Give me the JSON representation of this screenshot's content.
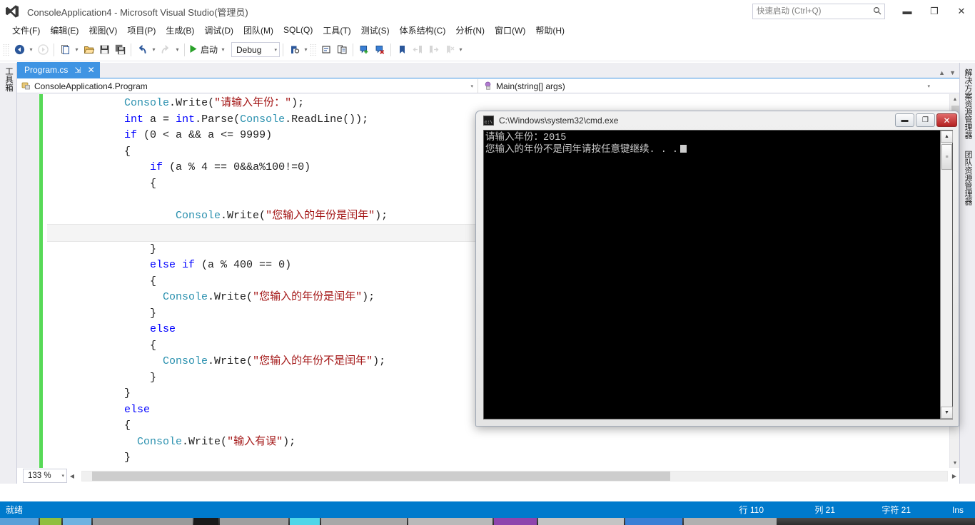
{
  "titlebar": {
    "title": "ConsoleApplication4 - Microsoft Visual Studio(管理员)",
    "logo_icon": "visual-studio-logo",
    "quick_launch_placeholder": "快速启动 (Ctrl+Q)",
    "quick_launch_value": "",
    "search_icon": "search-icon",
    "minimize_icon": "minimize-icon",
    "maximize_icon": "maximize-restore-icon",
    "close_icon": "close-icon",
    "minimize_glyph": "▬",
    "maximize_glyph": "❐",
    "close_glyph": "✕"
  },
  "menubar": {
    "items": [
      {
        "label": "文件(F)"
      },
      {
        "label": "编辑(E)"
      },
      {
        "label": "视图(V)"
      },
      {
        "label": "项目(P)"
      },
      {
        "label": "生成(B)"
      },
      {
        "label": "调试(D)"
      },
      {
        "label": "团队(M)"
      },
      {
        "label": "SQL(Q)"
      },
      {
        "label": "工具(T)"
      },
      {
        "label": "测试(S)"
      },
      {
        "label": "体系结构(C)"
      },
      {
        "label": "分析(N)"
      },
      {
        "label": "窗口(W)"
      },
      {
        "label": "帮助(H)"
      }
    ]
  },
  "toolbar": {
    "nav_back_icon": "navigate-back-icon",
    "nav_back_glyph": "◀",
    "nav_forward_icon": "navigate-forward-icon",
    "nav_forward_glyph": "▶",
    "new_project_icon": "new-project-icon",
    "new_project_glyph": "▤",
    "open_file_icon": "open-file-icon",
    "open_file_glyph": "🗁",
    "save_icon": "save-icon",
    "save_glyph": "▣",
    "save_all_icon": "save-all-icon",
    "save_all_glyph": "▥",
    "undo_icon": "undo-icon",
    "undo_glyph": "↺",
    "redo_icon": "redo-icon",
    "redo_glyph": "↻",
    "start_icon": "start-debug-icon",
    "start_glyph": "▶",
    "start_label": "启动",
    "config_value": "Debug",
    "attach_icon": "attach-to-process-icon",
    "attach_glyph": "⚑",
    "comment_icon": "comment-selection-icon",
    "comment_glyph": "▤",
    "uncomment_icon": "uncomment-selection-icon",
    "uncomment_glyph": "▥",
    "add_bookmark_icon": "add-watch-icon",
    "add_bookmark_glyph": "⊕",
    "remove_bookmark_icon": "remove-watch-icon",
    "remove_bookmark_glyph": "⊗",
    "bookmark_icon": "bookmark-icon",
    "bookmark_glyph": "🔖",
    "prev_bookmark_icon": "previous-bookmark-icon",
    "prev_bookmark_glyph": "⇤",
    "next_bookmark_icon": "next-bookmark-icon",
    "next_bookmark_glyph": "⇥",
    "clear_bookmark_icon": "clear-bookmarks-icon",
    "clear_bookmark_glyph": "⇥",
    "overflow_glyph": "▾"
  },
  "left_dock": {
    "tabs": [
      {
        "label": "工具箱",
        "name": "toolbox"
      }
    ]
  },
  "right_dock": {
    "tabs": [
      {
        "label": "解决方案资源管理器",
        "name": "solution-explorer"
      },
      {
        "label": "团队资源管理器",
        "name": "team-explorer"
      }
    ]
  },
  "tabstrip": {
    "active_tab": "Program.cs",
    "pin_icon": "pin-icon",
    "pin_glyph": "⇲",
    "close_icon": "close-tab-icon",
    "close_glyph": "✕",
    "nav_up_glyph": "▲",
    "nav_down_glyph": "▼"
  },
  "navbar": {
    "type_icon": "class-icon",
    "type_glyph": "◈",
    "type_value": "ConsoleApplication4.Program",
    "member_icon": "method-icon",
    "member_glyph": "◈",
    "member_value": "Main(string[] args)",
    "caret_glyph": "▾"
  },
  "editor": {
    "code_lines": [
      {
        "indent": 12,
        "highlight": false,
        "tokens": [
          {
            "c": "t",
            "x": "Console"
          },
          {
            "c": "n",
            "x": "."
          },
          {
            "c": "n",
            "x": "Write"
          },
          {
            "c": "n",
            "x": "("
          },
          {
            "c": "s",
            "x": "\"请输入年份：\""
          },
          {
            "c": "n",
            "x": ");"
          }
        ]
      },
      {
        "indent": 12,
        "highlight": false,
        "tokens": [
          {
            "c": "k",
            "x": "int"
          },
          {
            "c": "n",
            "x": " a = "
          },
          {
            "c": "k",
            "x": "int"
          },
          {
            "c": "n",
            "x": ".Parse("
          },
          {
            "c": "t",
            "x": "Console"
          },
          {
            "c": "n",
            "x": ".ReadLine());"
          }
        ]
      },
      {
        "indent": 12,
        "highlight": false,
        "tokens": [
          {
            "c": "k",
            "x": "if"
          },
          {
            "c": "n",
            "x": " (0 < a && a <= 9999)"
          }
        ]
      },
      {
        "indent": 12,
        "highlight": false,
        "tokens": [
          {
            "c": "n",
            "x": "{"
          }
        ]
      },
      {
        "indent": 16,
        "highlight": false,
        "tokens": [
          {
            "c": "k",
            "x": "if"
          },
          {
            "c": "n",
            "x": " (a % 4 == 0&&a%100!=0)"
          }
        ]
      },
      {
        "indent": 16,
        "highlight": false,
        "tokens": [
          {
            "c": "n",
            "x": "{"
          }
        ]
      },
      {
        "indent": 0,
        "highlight": false,
        "tokens": [
          {
            "c": "n",
            "x": ""
          }
        ]
      },
      {
        "indent": 20,
        "highlight": false,
        "tokens": [
          {
            "c": "t",
            "x": "Console"
          },
          {
            "c": "n",
            "x": ".Write("
          },
          {
            "c": "s",
            "x": "\"您输入的年份是闰年\""
          },
          {
            "c": "n",
            "x": ");"
          }
        ]
      },
      {
        "indent": 20,
        "highlight": true,
        "tokens": [
          {
            "c": "n",
            "x": ""
          }
        ]
      },
      {
        "indent": 16,
        "highlight": false,
        "tokens": [
          {
            "c": "n",
            "x": "}"
          }
        ]
      },
      {
        "indent": 16,
        "highlight": false,
        "tokens": [
          {
            "c": "k",
            "x": "else if"
          },
          {
            "c": "n",
            "x": " (a % 400 == 0)"
          }
        ]
      },
      {
        "indent": 16,
        "highlight": false,
        "tokens": [
          {
            "c": "n",
            "x": "{"
          }
        ]
      },
      {
        "indent": 18,
        "highlight": false,
        "tokens": [
          {
            "c": "t",
            "x": "Console"
          },
          {
            "c": "n",
            "x": ".Write("
          },
          {
            "c": "s",
            "x": "\"您输入的年份是闰年\""
          },
          {
            "c": "n",
            "x": ");"
          }
        ]
      },
      {
        "indent": 16,
        "highlight": false,
        "tokens": [
          {
            "c": "n",
            "x": "}"
          }
        ]
      },
      {
        "indent": 16,
        "highlight": false,
        "tokens": [
          {
            "c": "k",
            "x": "else"
          }
        ]
      },
      {
        "indent": 16,
        "highlight": false,
        "tokens": [
          {
            "c": "n",
            "x": "{"
          }
        ]
      },
      {
        "indent": 18,
        "highlight": false,
        "tokens": [
          {
            "c": "t",
            "x": "Console"
          },
          {
            "c": "n",
            "x": ".Write("
          },
          {
            "c": "s",
            "x": "\"您输入的年份不是闰年\""
          },
          {
            "c": "n",
            "x": ");"
          }
        ]
      },
      {
        "indent": 16,
        "highlight": false,
        "tokens": [
          {
            "c": "n",
            "x": "}"
          }
        ]
      },
      {
        "indent": 12,
        "highlight": false,
        "tokens": [
          {
            "c": "n",
            "x": "}"
          }
        ]
      },
      {
        "indent": 12,
        "highlight": false,
        "tokens": [
          {
            "c": "k",
            "x": "else"
          }
        ]
      },
      {
        "indent": 12,
        "highlight": false,
        "tokens": [
          {
            "c": "n",
            "x": "{"
          }
        ]
      },
      {
        "indent": 14,
        "highlight": false,
        "tokens": [
          {
            "c": "t",
            "x": "Console"
          },
          {
            "c": "n",
            "x": ".Write("
          },
          {
            "c": "s",
            "x": "\"输入有误\""
          },
          {
            "c": "n",
            "x": ");"
          }
        ]
      },
      {
        "indent": 12,
        "highlight": false,
        "tokens": [
          {
            "c": "n",
            "x": "}"
          }
        ]
      }
    ],
    "zoom_level": "133 %",
    "zoom_caret_glyph": "▾",
    "scroll_up_glyph": "▲",
    "scroll_down_glyph": "▼",
    "scroll_left_glyph": "◀",
    "scroll_right_glyph": "▶"
  },
  "cmd_window": {
    "title": "C:\\Windows\\system32\\cmd.exe",
    "app_icon": "cmd-console-icon",
    "icon_text": "c:\\",
    "minimize_glyph": "▬",
    "maximize_glyph": "❐",
    "close_glyph": "✕",
    "output_line1": "请输入年份：2015",
    "output_line2": "您输入的年份不是闰年请按任意键继续. . .",
    "scroll_up_glyph": "▲",
    "scroll_down_glyph": "▼",
    "thumb_glyph": "≡"
  },
  "statusbar": {
    "ready": "就绪",
    "line_label": "行 110",
    "col_label": "列 21",
    "char_label": "字符 21",
    "insert_mode": "Ins",
    "background": "#007acc"
  },
  "taskbar": {
    "items": [
      {
        "name": "start-orb",
        "color": "#5aa0d8",
        "width": 54
      },
      {
        "name": "quick-launch-1",
        "color": "#8fbf3f",
        "width": 30
      },
      {
        "name": "quick-launch-2",
        "color": "#6fb2e0",
        "width": 40
      },
      {
        "name": "task-explorer",
        "color": "#9a9a9a",
        "width": 140
      },
      {
        "name": "task-cmd",
        "color": "#1a1a1a",
        "width": 34
      },
      {
        "name": "task-browser",
        "color": "#9f9f9f",
        "width": 96
      },
      {
        "name": "task-media",
        "color": "#4fd6e8",
        "width": 42
      },
      {
        "name": "task-folder",
        "color": "#a8a8a8",
        "width": 120
      },
      {
        "name": "task-word",
        "color": "#b9b9b9",
        "width": 118
      },
      {
        "name": "task-vs",
        "color": "#8e44ad",
        "width": 60
      },
      {
        "name": "task-other",
        "color": "#c4c4c4",
        "width": 120
      },
      {
        "name": "task-blue",
        "color": "#3a7fd5",
        "width": 80
      },
      {
        "name": "task-grey",
        "color": "#b0b0b0",
        "width": 130
      }
    ]
  }
}
